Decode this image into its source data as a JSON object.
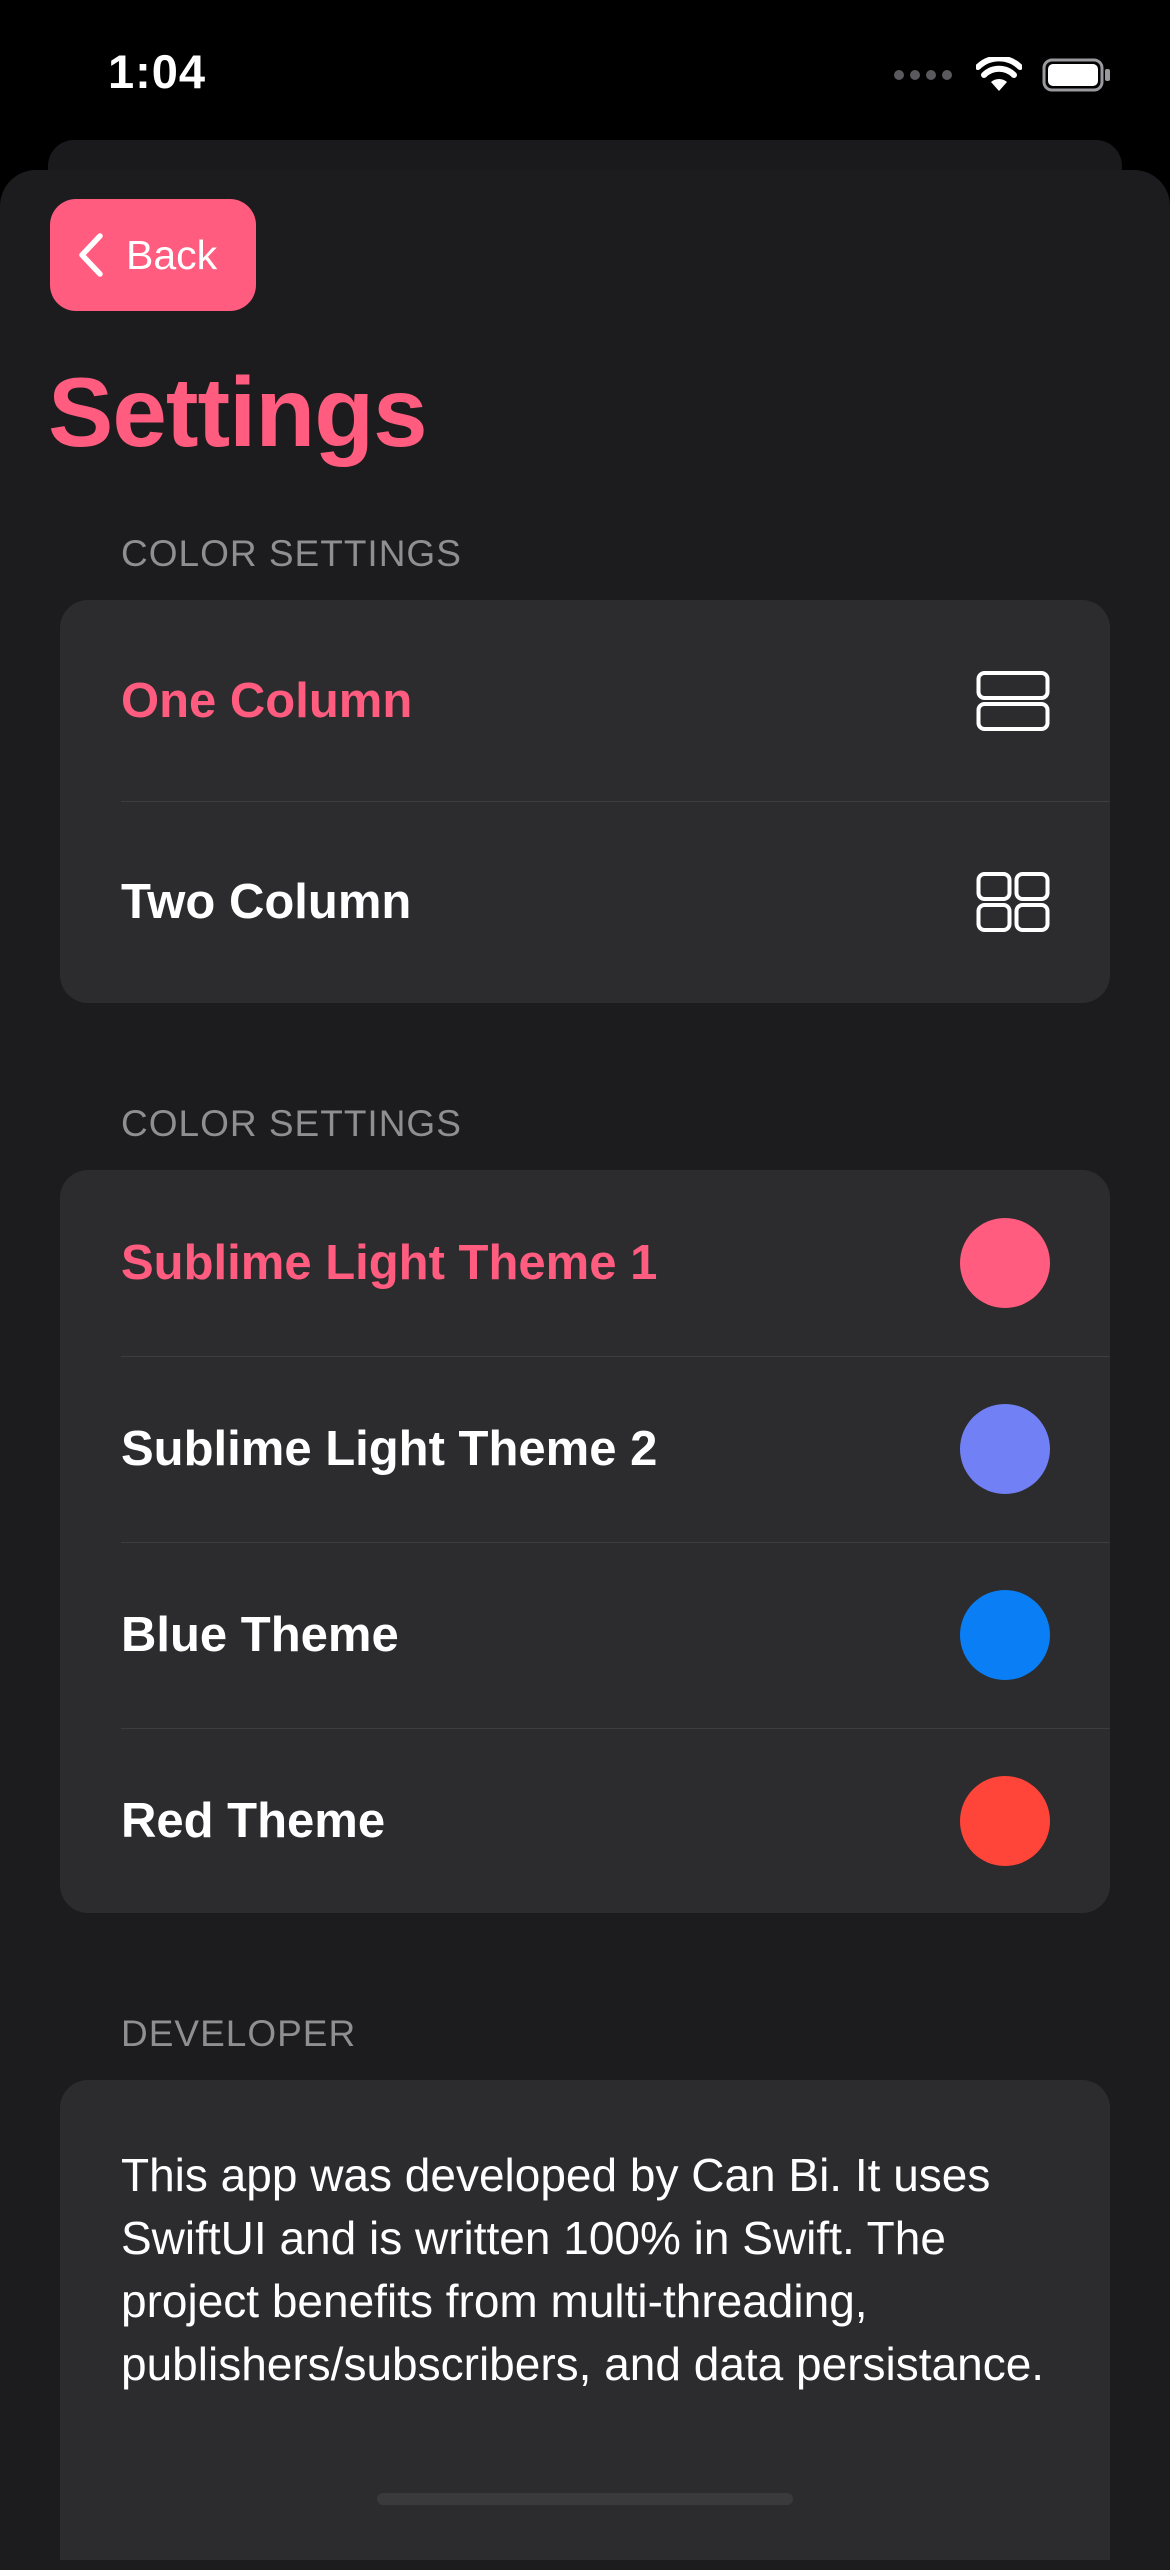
{
  "status_bar": {
    "time": "1:04"
  },
  "nav": {
    "back_label": "Back",
    "title": "Settings"
  },
  "sections": {
    "layout": {
      "header": "COLOR SETTINGS",
      "items": [
        {
          "label": "One Column",
          "icon": "one-column-layout-icon",
          "selected": true
        },
        {
          "label": "Two Column",
          "icon": "two-column-grid-icon",
          "selected": false
        }
      ]
    },
    "colors": {
      "header": "COLOR SETTINGS",
      "items": [
        {
          "label": "Sublime Light Theme 1",
          "color": "#ff5c7f",
          "selected": true
        },
        {
          "label": "Sublime Light Theme 2",
          "color": "#7180f5",
          "selected": false
        },
        {
          "label": "Blue Theme",
          "color": "#0a7ff5",
          "selected": false
        },
        {
          "label": "Red Theme",
          "color": "#ff453a",
          "selected": false
        }
      ]
    },
    "developer": {
      "header": "DEVELOPER",
      "text": "This app was developed by Can Bi. It uses SwiftUI and is written 100% in Swift. The project benefits from multi-threading, publishers/subscribers, and data persistance."
    }
  },
  "theme": {
    "accent": "#ff5c7f",
    "background": "#1c1c1e",
    "card": "#2c2c2e",
    "secondary_text": "#8e8e93"
  }
}
